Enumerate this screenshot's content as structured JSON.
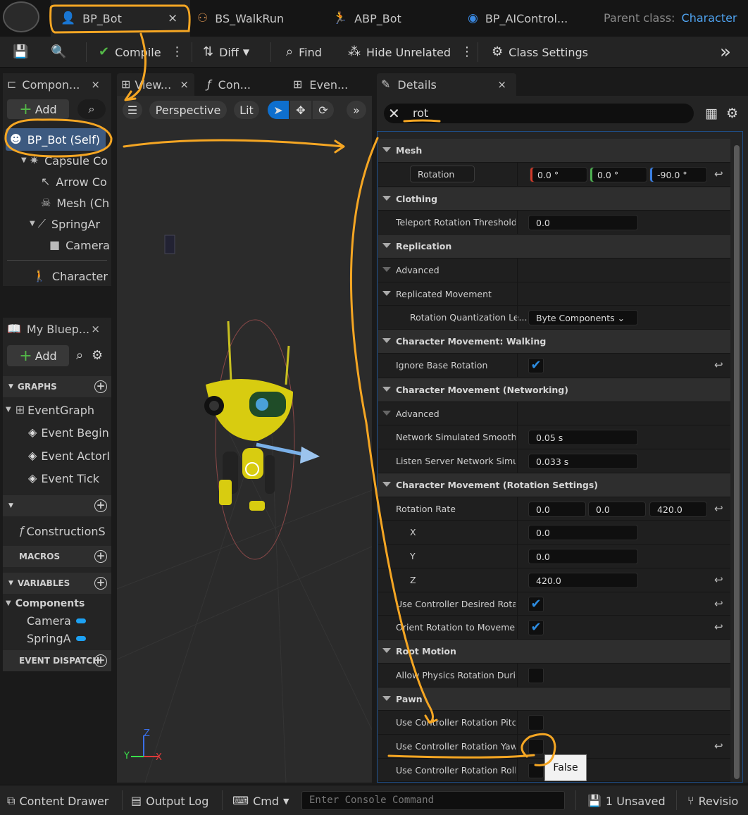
{
  "tabs": [
    {
      "label": "BP_Bot",
      "close": "×",
      "icon": "person-blueprint-icon"
    },
    {
      "label": "BS_WalkRun",
      "icon": "blendspace-icon"
    },
    {
      "label": "ABP_Bot",
      "icon": "animation-blueprint-icon"
    },
    {
      "label": "BP_AIControl...",
      "icon": "ai-controller-icon"
    }
  ],
  "parent_class": {
    "label": "Parent class:",
    "value": "Character"
  },
  "toolbar": {
    "compile": "Compile",
    "diff": "Diff",
    "find": "Find",
    "hide_unrelated": "Hide Unrelated",
    "class_settings": "Class Settings",
    "more": "»"
  },
  "components_panel": {
    "tab": "Compon...",
    "add": "Add",
    "items": [
      {
        "label": "BP_Bot (Self)"
      },
      {
        "label": "Capsule Co"
      },
      {
        "label": "Arrow Co"
      },
      {
        "label": "Mesh (Ch"
      },
      {
        "label": "SpringAr"
      },
      {
        "label": "Camera"
      },
      {
        "label": "Character M"
      }
    ]
  },
  "viewport_tabs": [
    {
      "label": "View...",
      "close": "×"
    },
    {
      "label": "Con..."
    },
    {
      "label": "Even..."
    }
  ],
  "viewport": {
    "perspective": "Perspective",
    "lit": "Lit",
    "axis_x": "X",
    "axis_y": "Y",
    "axis_z": "Z"
  },
  "my_blueprint": {
    "tab": "My Bluep...",
    "add": "Add",
    "graphs_header": "GRAPHS",
    "event_graph": "EventGraph",
    "events": [
      "Event Begin",
      "Event ActorI",
      "Event Tick"
    ],
    "construction": "ConstructionS",
    "macros_header": "MACROS",
    "variables_header": "VARIABLES",
    "components_header": "Components",
    "vars": [
      "Camera",
      "SpringAr"
    ],
    "dispatchers_header": "EVENT DISPATCH"
  },
  "details": {
    "tab": "Details",
    "search_value": "rot",
    "rows": [
      {
        "type": "cat",
        "label": "Mesh"
      },
      {
        "type": "rotation",
        "label": "Rotation",
        "values": [
          "0.0 °",
          "0.0 °",
          "-90.0 °"
        ]
      },
      {
        "type": "cat",
        "label": "Clothing"
      },
      {
        "type": "field",
        "label": "Teleport Rotation Threshold",
        "value": "0.0"
      },
      {
        "type": "cat",
        "label": "Replication"
      },
      {
        "type": "sub",
        "label": "Advanced"
      },
      {
        "type": "sub",
        "label": "Replicated Movement"
      },
      {
        "type": "combo",
        "label": "Rotation Quantization Le...",
        "value": "Byte Components"
      },
      {
        "type": "cat",
        "label": "Character Movement: Walking"
      },
      {
        "type": "check",
        "label": "Ignore Base Rotation",
        "checked": true
      },
      {
        "type": "cat",
        "label": "Character Movement (Networking)"
      },
      {
        "type": "sub",
        "label": "Advanced"
      },
      {
        "type": "field",
        "label": "Network Simulated Smooth...",
        "value": "0.05 s"
      },
      {
        "type": "field",
        "label": "Listen Server Network Simu...",
        "value": "0.033 s"
      },
      {
        "type": "cat",
        "label": "Character Movement (Rotation Settings)"
      },
      {
        "type": "vec",
        "label": "Rotation Rate",
        "values": [
          "0.0",
          "0.0",
          "420.0"
        ]
      },
      {
        "type": "field",
        "label": "X",
        "value": "0.0"
      },
      {
        "type": "field",
        "label": "Y",
        "value": "0.0"
      },
      {
        "type": "field",
        "label": "Z",
        "value": "420.0"
      },
      {
        "type": "check",
        "label": "Use Controller Desired Rota...",
        "checked": true
      },
      {
        "type": "check",
        "label": "Orient Rotation to Movement",
        "checked": true
      },
      {
        "type": "cat",
        "label": "Root Motion"
      },
      {
        "type": "check",
        "label": "Allow Physics Rotation Duri...",
        "checked": false
      },
      {
        "type": "cat",
        "label": "Pawn"
      },
      {
        "type": "check",
        "label": "Use Controller Rotation Pitch",
        "checked": false
      },
      {
        "type": "check",
        "label": "Use Controller Rotation Yaw",
        "checked": false
      },
      {
        "type": "check",
        "label": "Use Controller Rotation Roll",
        "checked": false
      }
    ],
    "tooltip": "False"
  },
  "statusbar": {
    "content_drawer": "Content Drawer",
    "output_log": "Output Log",
    "cmd": "Cmd",
    "console_placeholder": "Enter Console Command",
    "unsaved": "1 Unsaved",
    "revision": "Revisio"
  },
  "colors": {
    "accent": "#2d8ce0",
    "annotation": "#f5a623",
    "select": "#0e6fce"
  }
}
